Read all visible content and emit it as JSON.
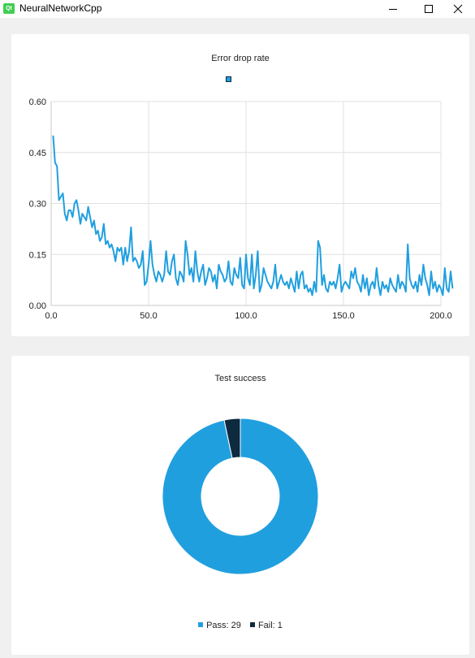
{
  "window": {
    "title": "NeuralNetworkCpp",
    "icon_text": "Qt",
    "buttons": [
      "minimize-icon",
      "maximize-icon",
      "close-icon"
    ]
  },
  "colors": {
    "accent": "#209fdf",
    "dark": "#0e2a3f",
    "grid": "#e0e0e0",
    "background": "#f0f0f0"
  },
  "chart_data": [
    {
      "type": "line",
      "title": "Error drop rate",
      "xlabel": "",
      "ylabel": "",
      "xlim": [
        0,
        200
      ],
      "ylim": [
        0,
        0.6
      ],
      "x_ticks": [
        "0.0",
        "50.0",
        "100.0",
        "150.0",
        "200.0"
      ],
      "y_ticks": [
        "0.00",
        "0.15",
        "0.30",
        "0.45",
        "0.60"
      ],
      "grid": true,
      "legend": "top-center",
      "series": [
        {
          "name": "",
          "color": "#209fdf",
          "x_start": 1,
          "x_step": 1,
          "values": [
            0.5,
            0.42,
            0.41,
            0.31,
            0.32,
            0.33,
            0.27,
            0.25,
            0.28,
            0.28,
            0.26,
            0.3,
            0.31,
            0.28,
            0.24,
            0.27,
            0.26,
            0.25,
            0.29,
            0.26,
            0.23,
            0.25,
            0.21,
            0.22,
            0.19,
            0.2,
            0.24,
            0.18,
            0.19,
            0.17,
            0.18,
            0.16,
            0.13,
            0.17,
            0.16,
            0.17,
            0.12,
            0.17,
            0.13,
            0.16,
            0.23,
            0.13,
            0.14,
            0.13,
            0.11,
            0.12,
            0.16,
            0.06,
            0.07,
            0.12,
            0.19,
            0.12,
            0.09,
            0.07,
            0.1,
            0.09,
            0.07,
            0.09,
            0.16,
            0.1,
            0.09,
            0.13,
            0.15,
            0.08,
            0.06,
            0.1,
            0.09,
            0.07,
            0.19,
            0.15,
            0.09,
            0.11,
            0.07,
            0.16,
            0.1,
            0.07,
            0.1,
            0.12,
            0.06,
            0.08,
            0.11,
            0.1,
            0.07,
            0.09,
            0.05,
            0.12,
            0.1,
            0.09,
            0.07,
            0.08,
            0.13,
            0.07,
            0.06,
            0.11,
            0.09,
            0.08,
            0.14,
            0.06,
            0.05,
            0.15,
            0.08,
            0.06,
            0.15,
            0.05,
            0.09,
            0.16,
            0.04,
            0.06,
            0.11,
            0.09,
            0.07,
            0.06,
            0.05,
            0.07,
            0.12,
            0.05,
            0.07,
            0.09,
            0.07,
            0.06,
            0.07,
            0.05,
            0.08,
            0.06,
            0.04,
            0.1,
            0.05,
            0.09,
            0.1,
            0.05,
            0.06,
            0.04,
            0.05,
            0.03,
            0.07,
            0.04,
            0.19,
            0.17,
            0.06,
            0.09,
            0.05,
            0.04,
            0.07,
            0.06,
            0.07,
            0.05,
            0.08,
            0.12,
            0.04,
            0.06,
            0.07,
            0.06,
            0.05,
            0.1,
            0.08,
            0.11,
            0.07,
            0.06,
            0.04,
            0.09,
            0.05,
            0.08,
            0.03,
            0.06,
            0.07,
            0.05,
            0.11,
            0.06,
            0.03,
            0.07,
            0.05,
            0.06,
            0.04,
            0.08,
            0.06,
            0.05,
            0.04,
            0.09,
            0.05,
            0.07,
            0.06,
            0.04,
            0.18,
            0.08,
            0.06,
            0.05,
            0.07,
            0.04,
            0.09,
            0.06,
            0.12,
            0.08,
            0.06,
            0.03,
            0.1,
            0.05,
            0.07,
            0.04,
            0.06,
            0.05,
            0.03,
            0.11,
            0.05,
            0.04,
            0.1,
            0.05
          ]
        }
      ]
    },
    {
      "type": "pie",
      "title": "Test success",
      "hole": 0.5,
      "legend": "bottom",
      "slices": [
        {
          "label": "Pass: 29",
          "value": 29,
          "color": "#209fdf"
        },
        {
          "label": "Fail: 1",
          "value": 1,
          "color": "#0e2a3f"
        }
      ]
    }
  ]
}
